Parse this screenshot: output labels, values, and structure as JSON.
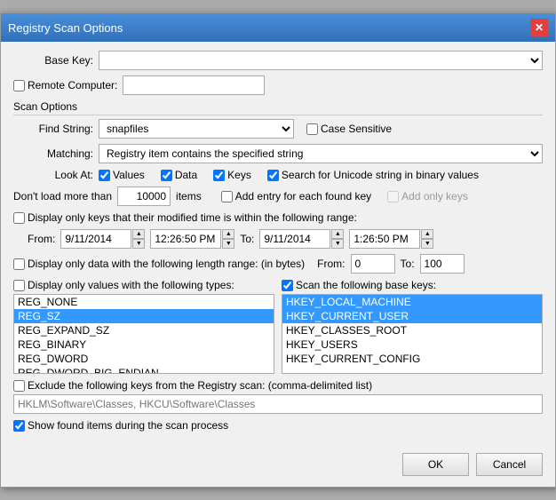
{
  "title": "Registry Scan Options",
  "titlebar": {
    "close_label": "✕"
  },
  "base_key": {
    "label": "Base Key:",
    "value": "",
    "placeholder": ""
  },
  "remote_computer": {
    "label": "Remote Computer:",
    "checked": false,
    "value": ""
  },
  "scan_options_header": "Scan Options",
  "find_string": {
    "label": "Find String:",
    "value": "snapfiles",
    "placeholder": ""
  },
  "case_sensitive": {
    "label": "Case Sensitive",
    "checked": false
  },
  "matching": {
    "label": "Matching:",
    "value": "Registry item contains the specified string",
    "options": [
      "Registry item contains the specified string"
    ]
  },
  "look_at": {
    "label": "Look At:",
    "values_label": "Values",
    "values_checked": true,
    "data_label": "Data",
    "data_checked": true,
    "keys_label": "Keys",
    "keys_checked": true,
    "unicode_label": "Search for Unicode string in binary values",
    "unicode_checked": true
  },
  "dont_load": {
    "label": "Don't load more than",
    "value": "10000",
    "items_label": "items"
  },
  "add_entry": {
    "label": "Add entry for each found key",
    "checked": false
  },
  "add_only_keys": {
    "label": "Add only keys",
    "checked": false,
    "disabled": true
  },
  "display_modified": {
    "label": "Display only keys that their modified time is within the following range:",
    "checked": false
  },
  "from_label": "From:",
  "to_label": "To:",
  "from_date": "9/11/2014",
  "from_time": "12:26:50 PM",
  "to_date": "9/11/2014",
  "to_time": "1:26:50 PM",
  "display_length": {
    "label": "Display only data with the following length range: (in bytes)",
    "checked": false,
    "from_label": "From:",
    "from_value": "0",
    "to_label": "To:",
    "to_value": "100"
  },
  "display_types": {
    "label": "Display only values with the following types:",
    "checked": false,
    "items": [
      {
        "text": "REG_NONE",
        "selected": false
      },
      {
        "text": "REG_SZ",
        "selected": true
      },
      {
        "text": "REG_EXPAND_SZ",
        "selected": false
      },
      {
        "text": "REG_BINARY",
        "selected": false
      },
      {
        "text": "REG_DWORD",
        "selected": false
      },
      {
        "text": "REG_DWORD_BIG_ENDIAN",
        "selected": false
      }
    ]
  },
  "scan_base_keys": {
    "label": "Scan the following base keys:",
    "checked": true,
    "items": [
      {
        "text": "HKEY_LOCAL_MACHINE",
        "selected": true
      },
      {
        "text": "HKEY_CURRENT_USER",
        "selected": true
      },
      {
        "text": "HKEY_CLASSES_ROOT",
        "selected": false
      },
      {
        "text": "HKEY_USERS",
        "selected": false
      },
      {
        "text": "HKEY_CURRENT_CONFIG",
        "selected": false
      }
    ]
  },
  "exclude_keys": {
    "label": "Exclude the following keys from the Registry scan: (comma-delimited list)",
    "checked": false,
    "placeholder": "HKLM\\Software\\Classes, HKCU\\Software\\Classes"
  },
  "show_found": {
    "label": "Show found items during the scan process",
    "checked": true
  },
  "buttons": {
    "ok": "OK",
    "cancel": "Cancel"
  }
}
